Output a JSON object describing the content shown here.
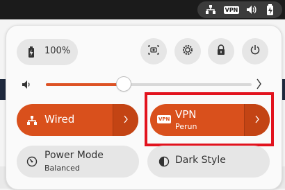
{
  "topbar": {
    "vpn_badge": "VPN"
  },
  "battery": {
    "label": "100%"
  },
  "toggles": {
    "wired": {
      "label": "Wired"
    },
    "vpn": {
      "label": "VPN",
      "sublabel": "Perun",
      "badge": "VPN"
    },
    "power_mode": {
      "label": "Power Mode",
      "sublabel": "Balanced"
    },
    "dark_style": {
      "label": "Dark Style"
    }
  },
  "volume": {
    "level": 0.38
  },
  "colors": {
    "accent": "#d9501c",
    "highlight": "#e2131e"
  },
  "icons": [
    "network-icon",
    "vpn-icon",
    "volume-icon",
    "battery-icon",
    "screenshot-icon",
    "settings-icon",
    "lock-icon",
    "power-icon",
    "chevron-right-icon",
    "power-mode-icon",
    "dark-style-icon"
  ]
}
